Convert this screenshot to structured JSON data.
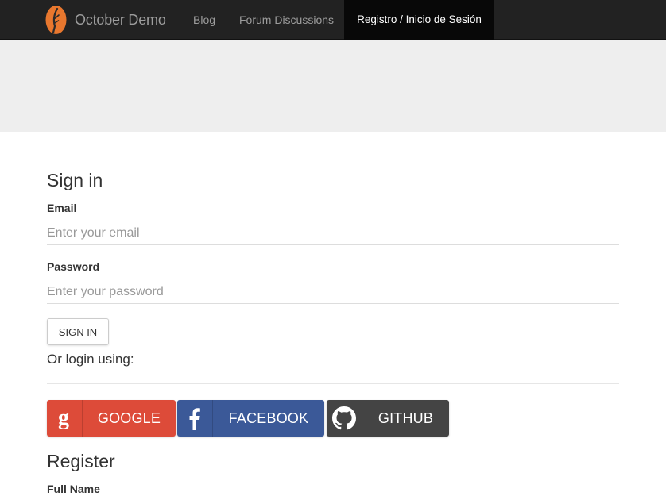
{
  "navbar": {
    "brand": "October Demo",
    "links": [
      "Blog",
      "Forum Discussions"
    ],
    "active_link": "Registro / Inicio de Sesión"
  },
  "signin": {
    "title": "Sign in",
    "email_label": "Email",
    "email_placeholder": "Enter your email",
    "password_label": "Password",
    "password_placeholder": "Enter your password",
    "submit_label": "SIGN IN",
    "or_text": "Or login using:"
  },
  "social": {
    "google": {
      "label": "GOOGLE",
      "color": "#dd4b39",
      "icon": "google-icon"
    },
    "facebook": {
      "label": "FACEBOOK",
      "color": "#3b5998",
      "icon": "facebook-icon"
    },
    "github": {
      "label": "GITHUB",
      "color": "#444444",
      "icon": "github-icon"
    }
  },
  "register": {
    "title": "Register",
    "fullname_label": "Full Name"
  },
  "colors": {
    "navbar_bg": "#222222",
    "active_nav_bg": "#080808",
    "banner_bg": "#eeeeee",
    "brand_orange": "#e8772e"
  }
}
